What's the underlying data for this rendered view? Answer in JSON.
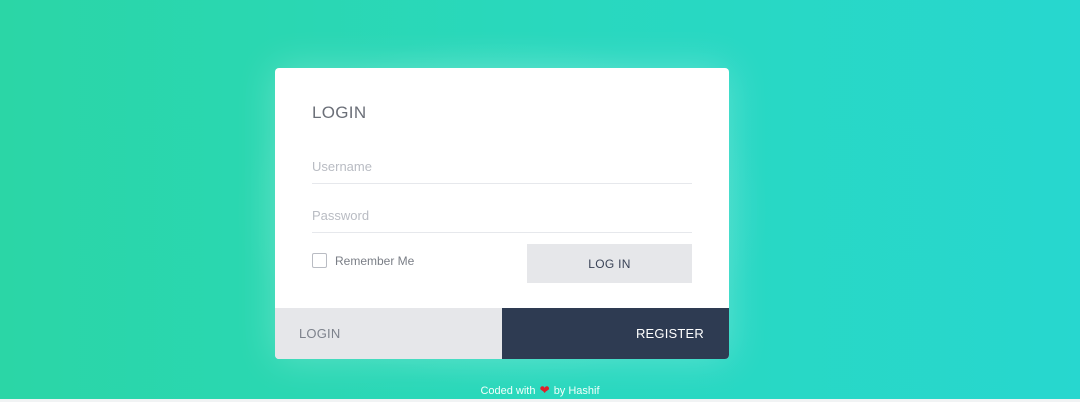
{
  "card": {
    "title": "LOGIN",
    "username_placeholder": "Username",
    "password_placeholder": "Password",
    "username_value": "",
    "password_value": "",
    "remember_label": "Remember Me",
    "remember_checked": false,
    "login_button_label": "LOG IN"
  },
  "tabs": {
    "login_label": "LOGIN",
    "register_label": "REGISTER",
    "active": "register"
  },
  "footer": {
    "prefix": "Coded with",
    "heart_icon": "heart-icon",
    "suffix": "by Hashif"
  },
  "colors": {
    "accent": "#2bd6a6",
    "dark": "#2e3b52",
    "heart": "#e0202a"
  }
}
